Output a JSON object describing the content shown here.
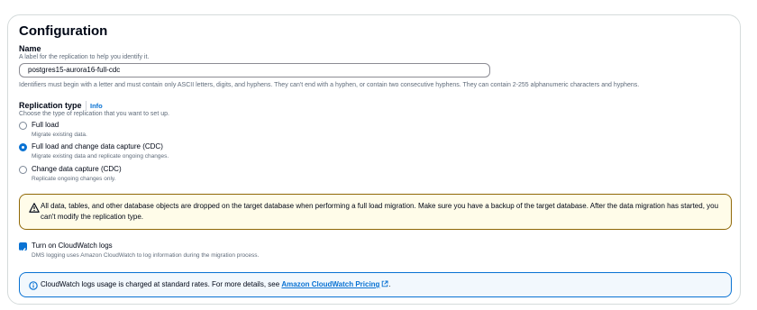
{
  "section": {
    "title": "Configuration"
  },
  "name_field": {
    "label": "Name",
    "description": "A label for the replication to help you identify it.",
    "value": "postgres15-aurora16-full-cdc",
    "constraint": "Identifiers must begin with a letter and must contain only ASCII letters, digits, and hyphens. They can't end with a hyphen, or contain two consecutive hyphens. They can contain 2-255 alphanumeric characters and hyphens."
  },
  "replication_type": {
    "label": "Replication type",
    "info_link": "Info",
    "description": "Choose the type of replication that you want to set up.",
    "options": [
      {
        "label": "Full load",
        "description": "Migrate existing data.",
        "checked": false
      },
      {
        "label": "Full load and change data capture (CDC)",
        "description": "Migrate existing data and replicate ongoing changes.",
        "checked": true
      },
      {
        "label": "Change data capture (CDC)",
        "description": "Replicate ongoing changes only.",
        "checked": false
      }
    ]
  },
  "warning": {
    "icon": "warning-icon",
    "text": "All data, tables, and other database objects are dropped on the target database when performing a full load migration. Make sure you have a backup of the target database. After the data migration has started, you can't modify the replication type."
  },
  "cloudwatch": {
    "label": "Turn on CloudWatch logs",
    "description": "DMS logging uses Amazon CloudWatch to log information during the migration process.",
    "checked": true
  },
  "info_alert": {
    "icon": "info-icon",
    "text_before": "CloudWatch logs usage is charged at standard rates. For more details, see ",
    "link": "Amazon CloudWatch Pricing",
    "text_after": "."
  },
  "colors": {
    "accent": "#0972d3",
    "warning_border": "#906806",
    "warning_bg": "#fffce9",
    "info_bg": "#f2f8fd"
  }
}
